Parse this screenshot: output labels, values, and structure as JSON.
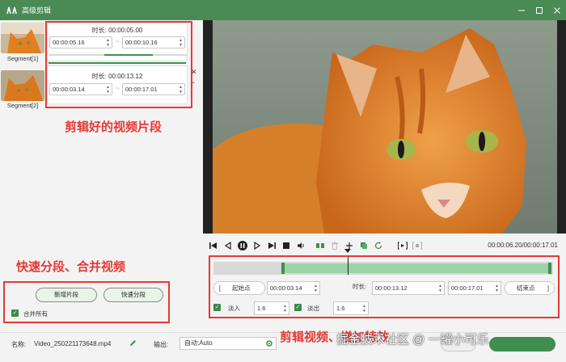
{
  "window": {
    "title": "高级剪辑"
  },
  "segments": [
    {
      "label": "Segment[1]",
      "duration_label": "时长:",
      "duration": "00:00:05.00",
      "start": "00:00:05.16",
      "end": "00:00:10.16"
    },
    {
      "label": "Segment[2]",
      "duration_label": "时长:",
      "duration": "00:00:13.12",
      "start": "00:00:03.14",
      "end": "00:00:17.01"
    }
  ],
  "buttons": {
    "new_segment": "新增片段",
    "quick_split": "快速分段"
  },
  "merge_all": {
    "label": "合并所有",
    "checked": true
  },
  "controls": {
    "time_readout": "00:00:06.20/00:00:17.01"
  },
  "trim": {
    "start_label": "起始点",
    "start_value": "00:00:03.14",
    "duration_label": "时长:",
    "duration_value": "00:00:13.12",
    "end_value": "00:00:17.01",
    "end_label": "结束点"
  },
  "fade": {
    "in_label": "淡入",
    "in_value": "1.6",
    "out_label": "淡出",
    "out_value": "1.6"
  },
  "bottom": {
    "name_label": "名称:",
    "name_value": "Video_250221173648.mp4",
    "output_label": "输出:",
    "output_value": "自动;Auto"
  },
  "annotations": {
    "segments": "剪辑好的视频片段",
    "split_merge": "快速分段、合并视频",
    "effects": "剪辑视频、增加特效"
  },
  "watermark": "掘金技术社区 @ 一罐小可乐",
  "colors": {
    "accent": "#3f8f4f",
    "title_bar": "#4a8a55",
    "annotation_red": "#e53935"
  }
}
